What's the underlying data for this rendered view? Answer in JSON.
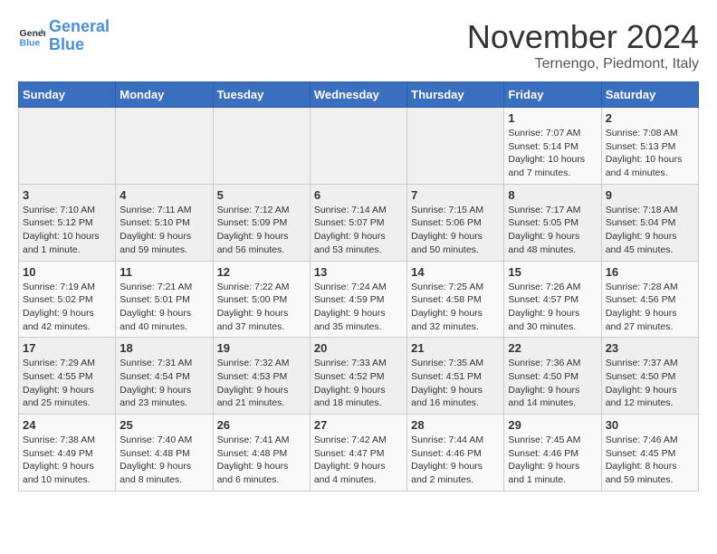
{
  "logo": {
    "text_general": "General",
    "text_blue": "Blue"
  },
  "title": "November 2024",
  "location": "Ternengo, Piedmont, Italy",
  "days_of_week": [
    "Sunday",
    "Monday",
    "Tuesday",
    "Wednesday",
    "Thursday",
    "Friday",
    "Saturday"
  ],
  "weeks": [
    [
      {
        "day": "",
        "info": ""
      },
      {
        "day": "",
        "info": ""
      },
      {
        "day": "",
        "info": ""
      },
      {
        "day": "",
        "info": ""
      },
      {
        "day": "",
        "info": ""
      },
      {
        "day": "1",
        "info": "Sunrise: 7:07 AM\nSunset: 5:14 PM\nDaylight: 10 hours and 7 minutes."
      },
      {
        "day": "2",
        "info": "Sunrise: 7:08 AM\nSunset: 5:13 PM\nDaylight: 10 hours and 4 minutes."
      }
    ],
    [
      {
        "day": "3",
        "info": "Sunrise: 7:10 AM\nSunset: 5:12 PM\nDaylight: 10 hours and 1 minute."
      },
      {
        "day": "4",
        "info": "Sunrise: 7:11 AM\nSunset: 5:10 PM\nDaylight: 9 hours and 59 minutes."
      },
      {
        "day": "5",
        "info": "Sunrise: 7:12 AM\nSunset: 5:09 PM\nDaylight: 9 hours and 56 minutes."
      },
      {
        "day": "6",
        "info": "Sunrise: 7:14 AM\nSunset: 5:07 PM\nDaylight: 9 hours and 53 minutes."
      },
      {
        "day": "7",
        "info": "Sunrise: 7:15 AM\nSunset: 5:06 PM\nDaylight: 9 hours and 50 minutes."
      },
      {
        "day": "8",
        "info": "Sunrise: 7:17 AM\nSunset: 5:05 PM\nDaylight: 9 hours and 48 minutes."
      },
      {
        "day": "9",
        "info": "Sunrise: 7:18 AM\nSunset: 5:04 PM\nDaylight: 9 hours and 45 minutes."
      }
    ],
    [
      {
        "day": "10",
        "info": "Sunrise: 7:19 AM\nSunset: 5:02 PM\nDaylight: 9 hours and 42 minutes."
      },
      {
        "day": "11",
        "info": "Sunrise: 7:21 AM\nSunset: 5:01 PM\nDaylight: 9 hours and 40 minutes."
      },
      {
        "day": "12",
        "info": "Sunrise: 7:22 AM\nSunset: 5:00 PM\nDaylight: 9 hours and 37 minutes."
      },
      {
        "day": "13",
        "info": "Sunrise: 7:24 AM\nSunset: 4:59 PM\nDaylight: 9 hours and 35 minutes."
      },
      {
        "day": "14",
        "info": "Sunrise: 7:25 AM\nSunset: 4:58 PM\nDaylight: 9 hours and 32 minutes."
      },
      {
        "day": "15",
        "info": "Sunrise: 7:26 AM\nSunset: 4:57 PM\nDaylight: 9 hours and 30 minutes."
      },
      {
        "day": "16",
        "info": "Sunrise: 7:28 AM\nSunset: 4:56 PM\nDaylight: 9 hours and 27 minutes."
      }
    ],
    [
      {
        "day": "17",
        "info": "Sunrise: 7:29 AM\nSunset: 4:55 PM\nDaylight: 9 hours and 25 minutes."
      },
      {
        "day": "18",
        "info": "Sunrise: 7:31 AM\nSunset: 4:54 PM\nDaylight: 9 hours and 23 minutes."
      },
      {
        "day": "19",
        "info": "Sunrise: 7:32 AM\nSunset: 4:53 PM\nDaylight: 9 hours and 21 minutes."
      },
      {
        "day": "20",
        "info": "Sunrise: 7:33 AM\nSunset: 4:52 PM\nDaylight: 9 hours and 18 minutes."
      },
      {
        "day": "21",
        "info": "Sunrise: 7:35 AM\nSunset: 4:51 PM\nDaylight: 9 hours and 16 minutes."
      },
      {
        "day": "22",
        "info": "Sunrise: 7:36 AM\nSunset: 4:50 PM\nDaylight: 9 hours and 14 minutes."
      },
      {
        "day": "23",
        "info": "Sunrise: 7:37 AM\nSunset: 4:50 PM\nDaylight: 9 hours and 12 minutes."
      }
    ],
    [
      {
        "day": "24",
        "info": "Sunrise: 7:38 AM\nSunset: 4:49 PM\nDaylight: 9 hours and 10 minutes."
      },
      {
        "day": "25",
        "info": "Sunrise: 7:40 AM\nSunset: 4:48 PM\nDaylight: 9 hours and 8 minutes."
      },
      {
        "day": "26",
        "info": "Sunrise: 7:41 AM\nSunset: 4:48 PM\nDaylight: 9 hours and 6 minutes."
      },
      {
        "day": "27",
        "info": "Sunrise: 7:42 AM\nSunset: 4:47 PM\nDaylight: 9 hours and 4 minutes."
      },
      {
        "day": "28",
        "info": "Sunrise: 7:44 AM\nSunset: 4:46 PM\nDaylight: 9 hours and 2 minutes."
      },
      {
        "day": "29",
        "info": "Sunrise: 7:45 AM\nSunset: 4:46 PM\nDaylight: 9 hours and 1 minute."
      },
      {
        "day": "30",
        "info": "Sunrise: 7:46 AM\nSunset: 4:45 PM\nDaylight: 8 hours and 59 minutes."
      }
    ]
  ]
}
